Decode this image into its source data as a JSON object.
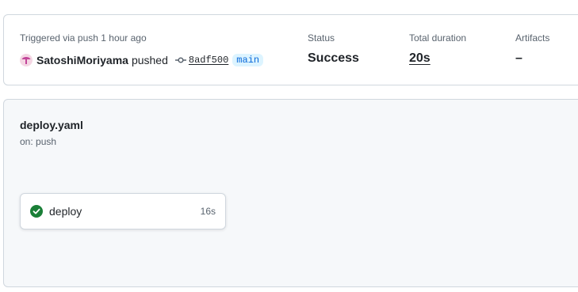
{
  "summary": {
    "trigger_text": "Triggered via push 1 hour ago",
    "actor": "SatoshiMoriyama",
    "action": "pushed",
    "commit_sha": "8adf500",
    "branch": "main",
    "status_label": "Status",
    "status_value": "Success",
    "duration_label": "Total duration",
    "duration_value": "20s",
    "artifacts_label": "Artifacts",
    "artifacts_value": "–"
  },
  "workflow": {
    "file_name": "deploy.yaml",
    "trigger": "on: push",
    "jobs": [
      {
        "name": "deploy",
        "duration": "16s",
        "status": "success"
      }
    ]
  },
  "colors": {
    "success": "#1a7f37",
    "branch_text": "#0969da",
    "branch_bg": "#ddf4ff",
    "border": "#d0d7de",
    "panel_bg": "#f6f8fa"
  },
  "icons": {
    "avatar": "avatar-icon",
    "commit": "git-commit-icon",
    "job_status": "check-circle-icon"
  }
}
